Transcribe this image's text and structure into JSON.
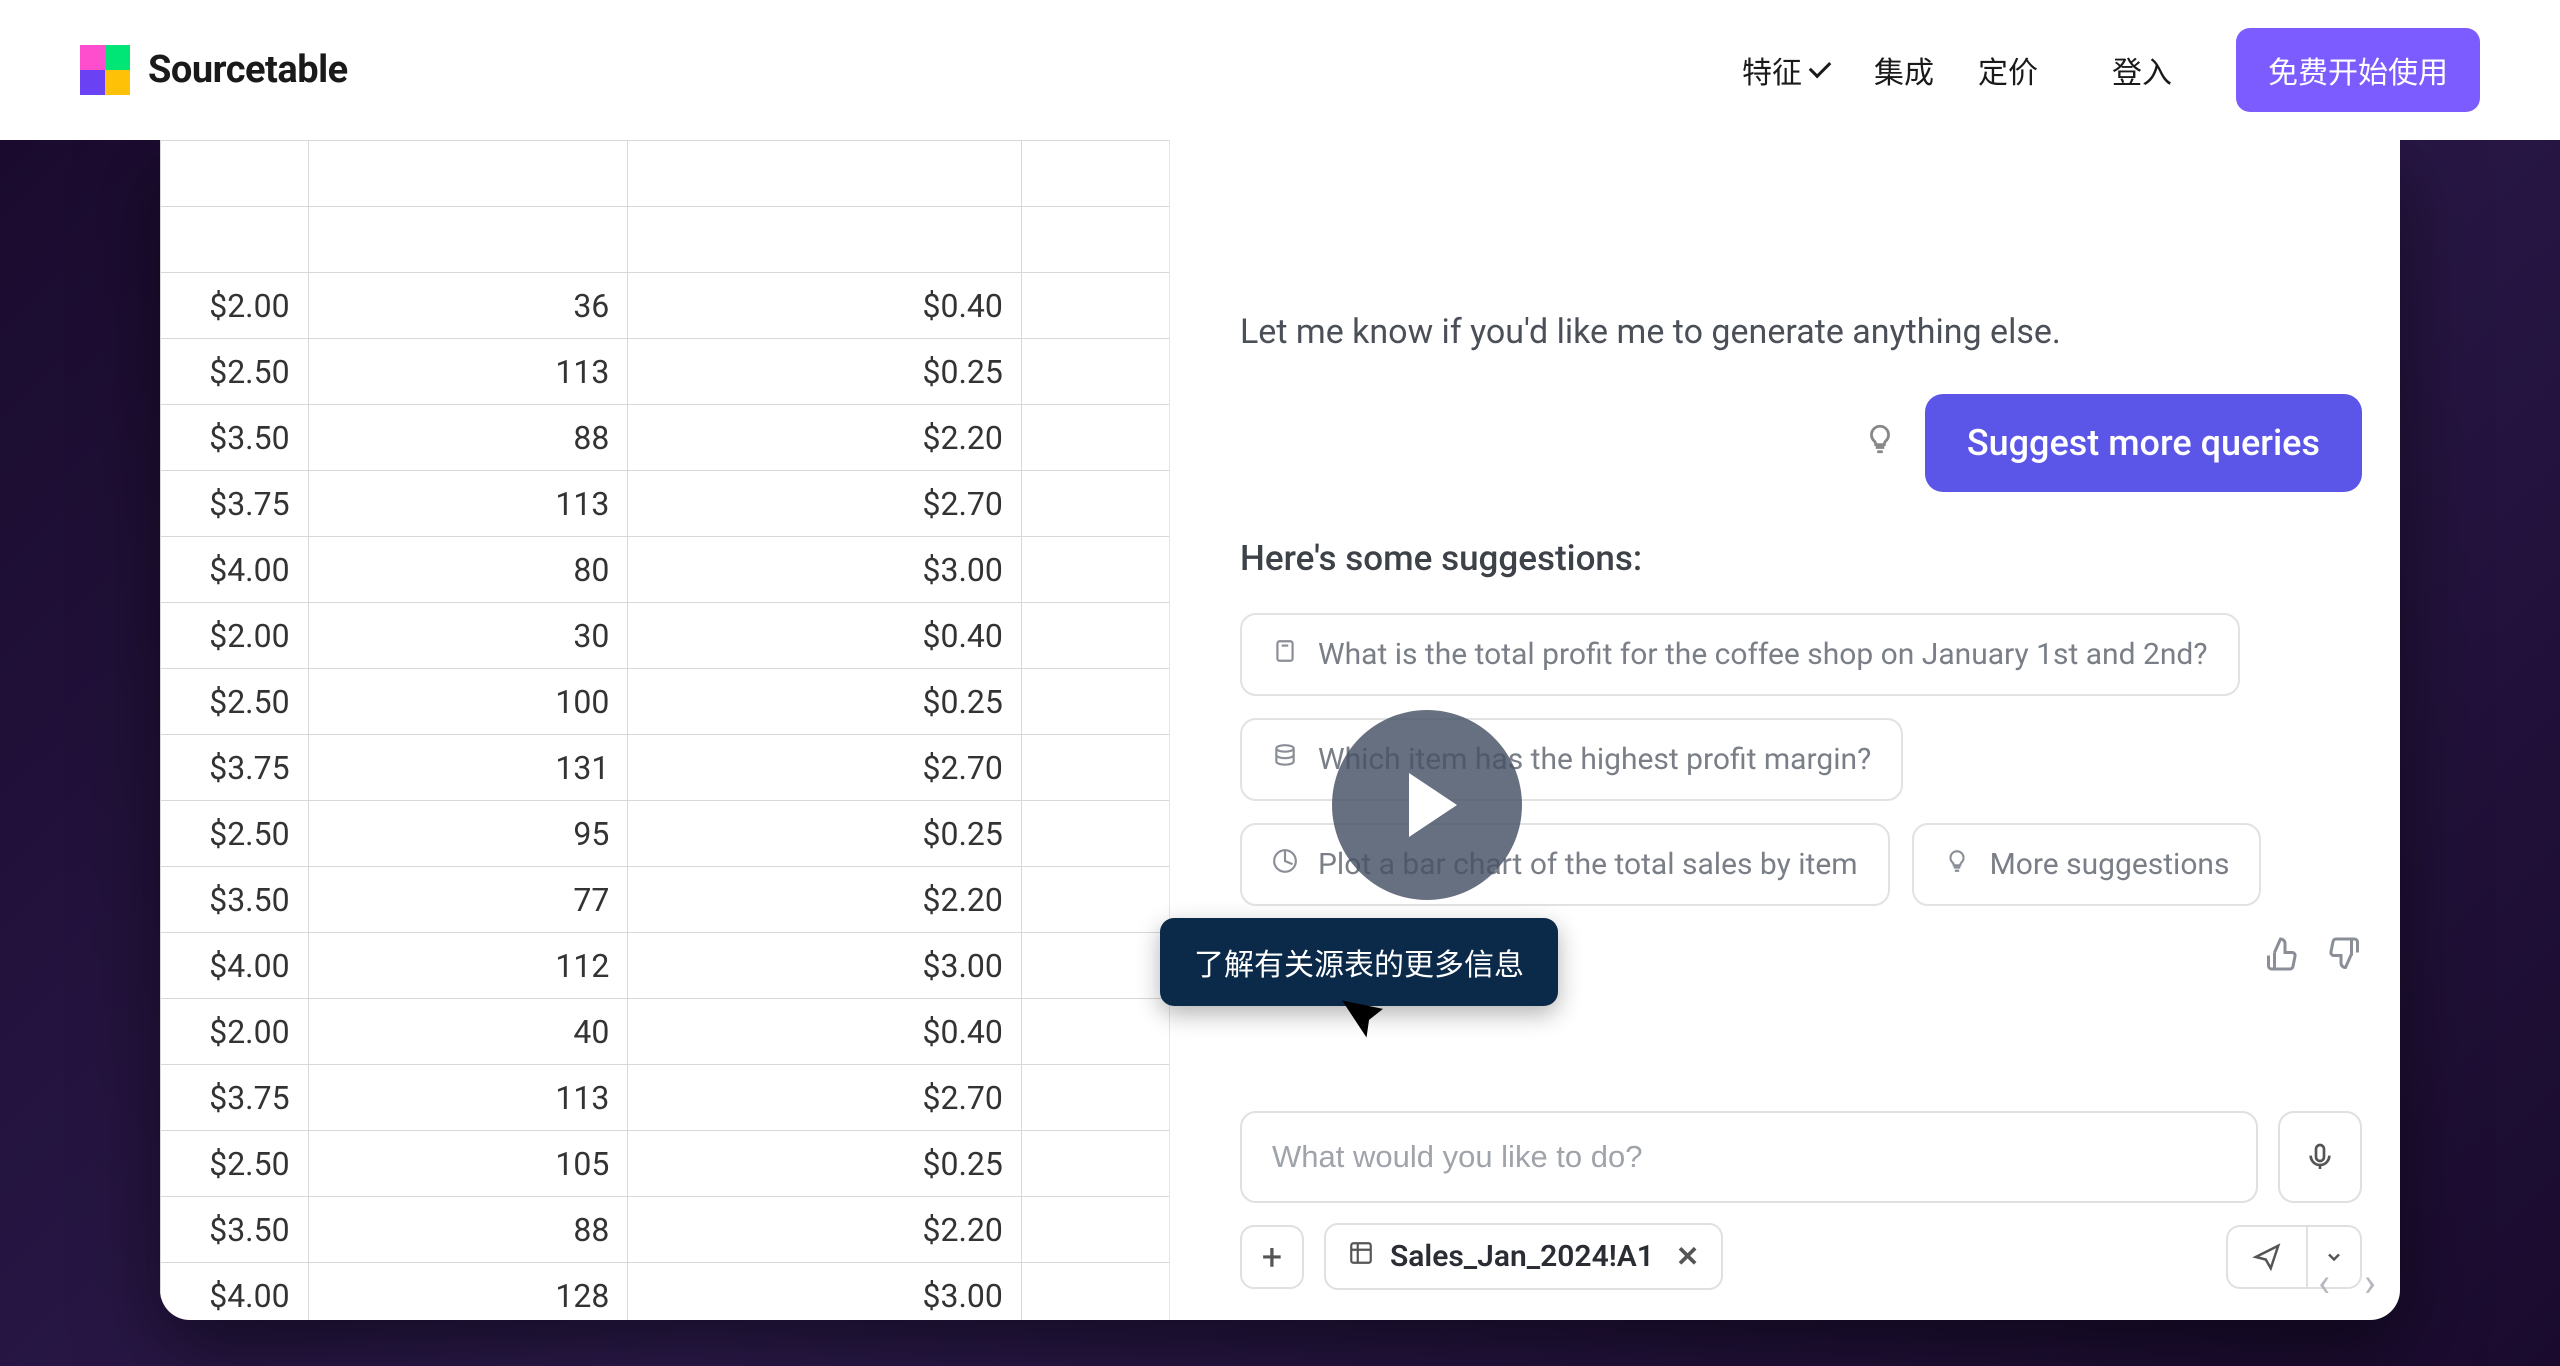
{
  "nav": {
    "brand": "Sourcetable",
    "features": "特征",
    "integrations": "集成",
    "pricing": "定价",
    "login": "登入",
    "cta": "免费开始使用"
  },
  "sheet": {
    "rows": [
      {
        "a": "",
        "b": "",
        "c": ""
      },
      {
        "a": "",
        "b": "",
        "c": ""
      },
      {
        "a": "$2.00",
        "b": "36",
        "c": "$0.40"
      },
      {
        "a": "$2.50",
        "b": "113",
        "c": "$0.25"
      },
      {
        "a": "$3.50",
        "b": "88",
        "c": "$2.20"
      },
      {
        "a": "$3.75",
        "b": "113",
        "c": "$2.70"
      },
      {
        "a": "$4.00",
        "b": "80",
        "c": "$3.00"
      },
      {
        "a": "$2.00",
        "b": "30",
        "c": "$0.40"
      },
      {
        "a": "$2.50",
        "b": "100",
        "c": "$0.25"
      },
      {
        "a": "$3.75",
        "b": "131",
        "c": "$2.70"
      },
      {
        "a": "$2.50",
        "b": "95",
        "c": "$0.25"
      },
      {
        "a": "$3.50",
        "b": "77",
        "c": "$2.20"
      },
      {
        "a": "$4.00",
        "b": "112",
        "c": "$3.00"
      },
      {
        "a": "$2.00",
        "b": "40",
        "c": "$0.40"
      },
      {
        "a": "$3.75",
        "b": "113",
        "c": "$2.70"
      },
      {
        "a": "$2.50",
        "b": "105",
        "c": "$0.25"
      },
      {
        "a": "$3.50",
        "b": "88",
        "c": "$2.20"
      },
      {
        "a": "$4.00",
        "b": "128",
        "c": "$3.00"
      }
    ]
  },
  "chat": {
    "ghost_button": "",
    "closing": "Let me know if you'd like me to generate anything else.",
    "suggest_button": "Suggest more queries",
    "suggestions_heading": "Here's some suggestions:",
    "suggestions": [
      "What is the total profit for the coffee shop on January 1st and 2nd?",
      "Which item has the highest profit margin?",
      "Plot a bar chart of the total sales by item",
      "More suggestions"
    ],
    "tooltip": "了解有关源表的更多信息",
    "input_placeholder": "What would you like to do?",
    "context_chip": "Sales_Jan_2024!A1"
  }
}
